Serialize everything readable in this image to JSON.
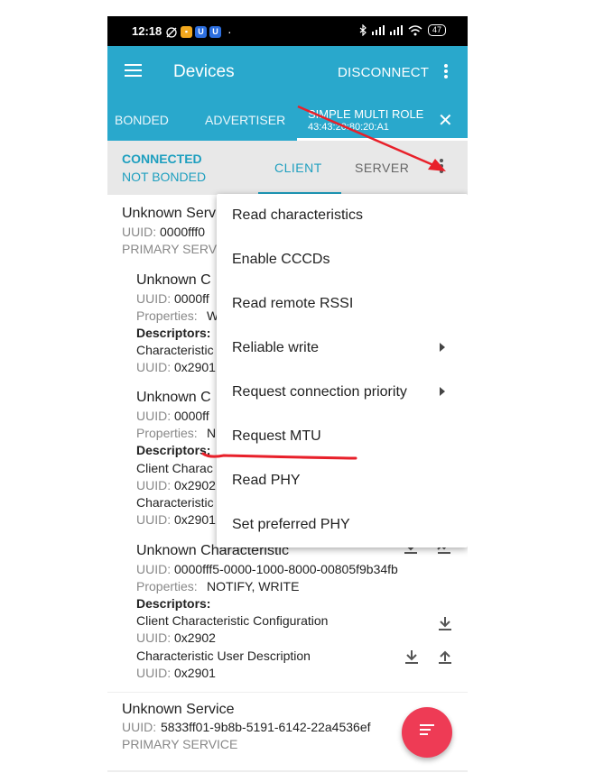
{
  "status_bar": {
    "time": "12:18",
    "battery": "47"
  },
  "appbar": {
    "title": "Devices",
    "disconnect_label": "DISCONNECT"
  },
  "tabs": {
    "bonded": "BONDED",
    "advertiser": "ADVERTISER",
    "active_name": "SIMPLE MULTI ROLE",
    "active_address": "43:43:20:80:20:A1"
  },
  "connection": {
    "state": "CONNECTED",
    "bond": "NOT BONDED"
  },
  "subtabs": {
    "client": "CLIENT",
    "server": "SERVER"
  },
  "services": [
    {
      "title": "Unknown Serv",
      "uuid_label": "UUID:",
      "uuid": "0000fff0",
      "type": "PRIMARY SERV",
      "characteristics": [
        {
          "title": "Unknown C",
          "uuid": "0000ff",
          "properties_label": "Properties:",
          "properties": "W",
          "descriptors_label": "Descriptors:",
          "desc1": "Characteristic",
          "desc1_uuid": "0x2901"
        },
        {
          "title": "Unknown C",
          "uuid": "0000ff",
          "properties_label": "Properties:",
          "properties": "N",
          "descriptors_label": "Descriptors:",
          "desc1": "Client Charac",
          "desc1_uuid": "0x2902",
          "desc2": "Characteristic",
          "desc2_uuid": "0x2901"
        },
        {
          "title": "Unknown Characteristic",
          "uuid": "0000fff5-0000-1000-8000-00805f9b34fb",
          "properties_label": "Properties:",
          "properties": "NOTIFY, WRITE",
          "descriptors_label": "Descriptors:",
          "desc1": "Client Characteristic Configuration",
          "desc1_uuid": "0x2902",
          "desc2": "Characteristic User Description",
          "desc2_uuid": "0x2901"
        }
      ]
    },
    {
      "title": "Unknown Service",
      "uuid_label": "UUID:",
      "uuid": "5833ff01-9b8b-5191-6142-22a4536ef",
      "type": "PRIMARY SERVICE"
    }
  ],
  "menu": {
    "items": [
      {
        "label": "Read characteristics",
        "submenu": false
      },
      {
        "label": "Enable CCCDs",
        "submenu": false
      },
      {
        "label": "Read remote RSSI",
        "submenu": false
      },
      {
        "label": "Reliable write",
        "submenu": true
      },
      {
        "label": "Request connection priority",
        "submenu": true
      },
      {
        "label": "Request MTU",
        "submenu": false
      },
      {
        "label": "Read PHY",
        "submenu": false
      },
      {
        "label": "Set preferred PHY",
        "submenu": false
      }
    ]
  },
  "colors": {
    "primary": "#29a8cc",
    "accent_text": "#1e9fbf",
    "fab": "#ee3b55",
    "annotation": "#e8202a"
  }
}
